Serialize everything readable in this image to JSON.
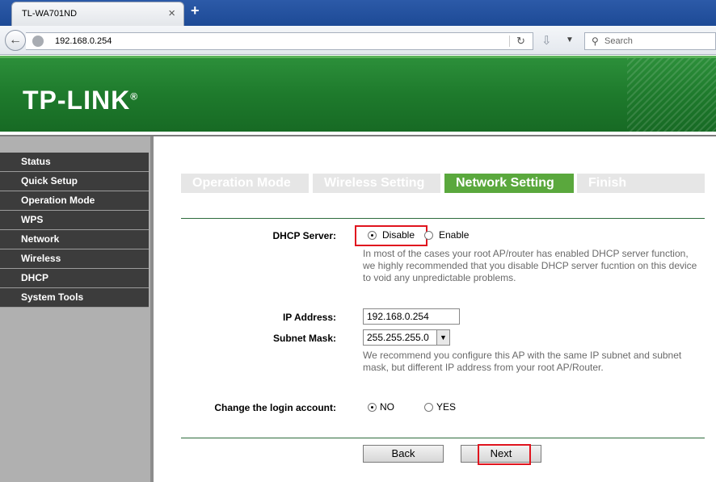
{
  "browser": {
    "tab_title": "TL-WA701ND",
    "tab_close": "×",
    "new_tab": "+",
    "url": "192.168.0.254",
    "search_placeholder": "Search"
  },
  "header": {
    "logo": "TP-LINK",
    "logo_mark": "®"
  },
  "sidebar": {
    "items": [
      {
        "label": "Status"
      },
      {
        "label": "Quick Setup"
      },
      {
        "label": "Operation Mode"
      },
      {
        "label": "WPS"
      },
      {
        "label": "Network"
      },
      {
        "label": "Wireless"
      },
      {
        "label": "DHCP"
      },
      {
        "label": "System Tools"
      }
    ]
  },
  "steps": [
    {
      "label": "Operation Mode",
      "active": false
    },
    {
      "label": "Wireless Setting",
      "active": false
    },
    {
      "label": "Network Setting",
      "active": true
    },
    {
      "label": "Finish",
      "active": false
    }
  ],
  "dhcp": {
    "label": "DHCP Server:",
    "opt_disable": "Disable",
    "opt_enable": "Enable",
    "selected": "Disable",
    "note_1": "In most of the cases your root AP/router has enabled DHCP server function,",
    "note_2": "we highly recommended that you disable DHCP server fucntion on this device",
    "note_3": "to void any unpredictable problems."
  },
  "ip": {
    "label": "IP Address:",
    "value": "192.168.0.254"
  },
  "mask": {
    "label": "Subnet Mask:",
    "value": "255.255.255.0",
    "note_1": "We recommend you configure this AP with the same IP subnet and subnet",
    "note_2": "mask, but different IP address from your root AP/Router."
  },
  "login": {
    "label": "Change the login account:",
    "opt_no": "NO",
    "opt_yes": "YES",
    "selected": "NO"
  },
  "buttons": {
    "back": "Back",
    "next": "Next"
  },
  "colors": {
    "brand_green": "#1e7a2c",
    "active_step": "#5aa83d",
    "highlight_red": "#e0141e"
  }
}
